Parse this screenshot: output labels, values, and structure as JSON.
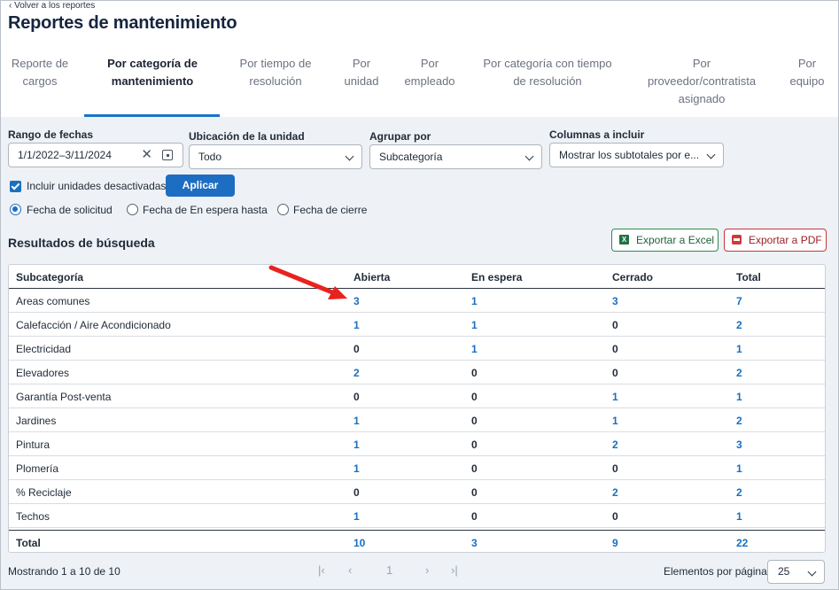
{
  "header": {
    "back_link": "‹ Volver a los reportes",
    "title": "Reportes de mantenimiento"
  },
  "tabs": [
    {
      "label_lines": [
        "Reporte de",
        "cargos"
      ],
      "active": false
    },
    {
      "label_lines": [
        "Por categoría de",
        "mantenimiento"
      ],
      "active": true
    },
    {
      "label_lines": [
        "Por tiempo de",
        "resolución"
      ],
      "active": false
    },
    {
      "label_lines": [
        "Por",
        "unidad"
      ],
      "active": false
    },
    {
      "label_lines": [
        "Por",
        "empleado"
      ],
      "active": false
    },
    {
      "label_lines": [
        "Por categoría con tiempo",
        "de resolución"
      ],
      "active": false
    },
    {
      "label_lines": [
        "Por",
        "proveedor/contratista",
        "asignado"
      ],
      "active": false
    },
    {
      "label_lines": [
        "Por",
        "equipo"
      ],
      "active": false
    }
  ],
  "filters": {
    "date_range": {
      "label": "Rango de fechas",
      "value": "1/1/2022–3/11/2024"
    },
    "location": {
      "label": "Ubicación de la unidad",
      "value": "Todo"
    },
    "group_by": {
      "label": "Agrupar por",
      "value": "Subcategoría"
    },
    "columns": {
      "label": "Columnas a incluir",
      "value": "Mostrar los subtotales por e..."
    },
    "include_inactive": {
      "label": "Incluir unidades desactivadas",
      "checked": true
    },
    "apply_label": "Aplicar",
    "date_type": {
      "options": [
        "Fecha de solicitud",
        "Fecha de En espera hasta",
        "Fecha de cierre"
      ],
      "selected": "Fecha de solicitud"
    }
  },
  "results": {
    "title": "Resultados de búsqueda",
    "export_excel": "Exportar a Excel",
    "export_pdf": "Exportar a PDF",
    "columns": [
      "Subcategoría",
      "Abierta",
      "En espera",
      "Cerrado",
      "Total"
    ],
    "rows": [
      {
        "name": "Areas comunes",
        "values": [
          "3",
          "1",
          "3",
          "7"
        ]
      },
      {
        "name": "Calefacción / Aire Acondicionado",
        "values": [
          "1",
          "1",
          "0",
          "2"
        ]
      },
      {
        "name": "Electricidad",
        "values": [
          "0",
          "1",
          "0",
          "1"
        ]
      },
      {
        "name": "Elevadores",
        "values": [
          "2",
          "0",
          "0",
          "2"
        ]
      },
      {
        "name": "Garantía Post-venta",
        "values": [
          "0",
          "0",
          "1",
          "1"
        ]
      },
      {
        "name": "Jardines",
        "values": [
          "1",
          "0",
          "1",
          "2"
        ]
      },
      {
        "name": "Pintura",
        "values": [
          "1",
          "0",
          "2",
          "3"
        ]
      },
      {
        "name": "Plomería",
        "values": [
          "1",
          "0",
          "0",
          "1"
        ]
      },
      {
        "name": "% Reciclaje",
        "values": [
          "0",
          "0",
          "2",
          "2"
        ]
      },
      {
        "name": "Techos",
        "values": [
          "1",
          "0",
          "0",
          "1"
        ]
      }
    ],
    "total": {
      "name": "Total",
      "values": [
        "10",
        "3",
        "9",
        "22"
      ]
    }
  },
  "footer": {
    "showing": "Mostrando 1 a 10 de 10",
    "pager": {
      "first": "|‹",
      "prev": "‹",
      "page": "1",
      "next": "›",
      "last": "›|"
    },
    "per_page_label": "Elementos por página",
    "per_page_value": "25"
  },
  "colors": {
    "accent": "#1a6fbf",
    "excel": "#207245",
    "pdf": "#d0393c",
    "annotation_arrow": "#e8231f"
  }
}
